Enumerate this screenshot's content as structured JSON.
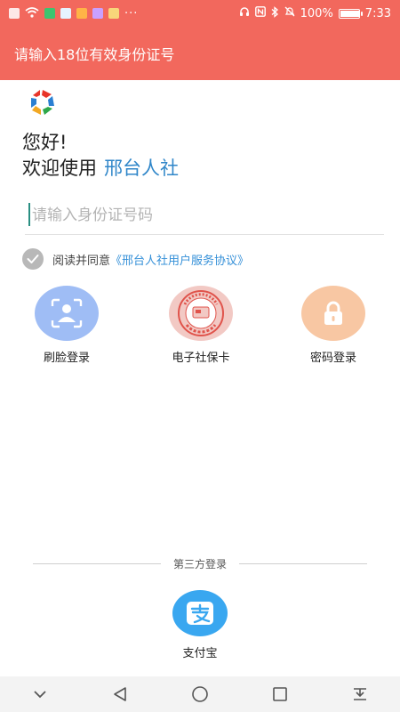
{
  "status_bar": {
    "battery": "100%",
    "time": "7:33",
    "notification_icons": [
      "sim-icon",
      "wifi-icon",
      "app-icon",
      "app-icon",
      "app-icon",
      "app-icon",
      "photo-icon"
    ],
    "more": "···"
  },
  "header": {
    "title": "请输入18位有效身份证号"
  },
  "brand": {
    "logo": "xingtai-renshe-logo",
    "greeting": "您好!",
    "welcome_prefix": "欢迎使用",
    "app_name": "邢台人社",
    "app_name_color": "#2f86c9"
  },
  "id_field": {
    "placeholder": "请输入身份证号码",
    "value": ""
  },
  "agreement": {
    "text": "阅读并同意",
    "link": "《邢台人社用户服务协议》",
    "checked": true
  },
  "login_options": [
    {
      "label": "刷脸登录",
      "icon": "face-scan-icon",
      "color": "#9fbdf5"
    },
    {
      "label": "电子社保卡",
      "icon": "social-security-card-icon",
      "color": "#f2c9c4"
    },
    {
      "label": "密码登录",
      "icon": "lock-icon",
      "color": "#f8c7a3"
    }
  ],
  "third_party": {
    "title": "第三方登录",
    "alipay_label": "支付宝",
    "alipay_color": "#39a7f0"
  },
  "colors": {
    "header_bg": "#f2685d",
    "link": "#3590d8"
  },
  "nav": [
    "chevron-down-icon",
    "back-icon",
    "home-icon",
    "recents-icon",
    "download-icon"
  ]
}
